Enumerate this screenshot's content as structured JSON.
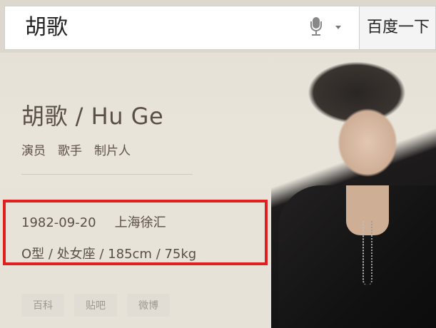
{
  "search": {
    "query": "胡歌",
    "button_label": "百度一下"
  },
  "profile": {
    "name": "胡歌 / Hu Ge",
    "roles": [
      "演员",
      "歌手",
      "制片人"
    ],
    "birth_date": "1982-09-20",
    "birthplace": "上海徐汇",
    "details": "O型 / 处女座 / 185cm / 75kg"
  },
  "links": [
    "百科",
    "贴吧",
    "微博"
  ],
  "colors": {
    "highlight_border": "#e02020",
    "background": "#e6e2d8",
    "text": "#5a4f46"
  },
  "icons": {
    "mic": "microphone-icon",
    "dropdown": "chevron-down-icon"
  }
}
